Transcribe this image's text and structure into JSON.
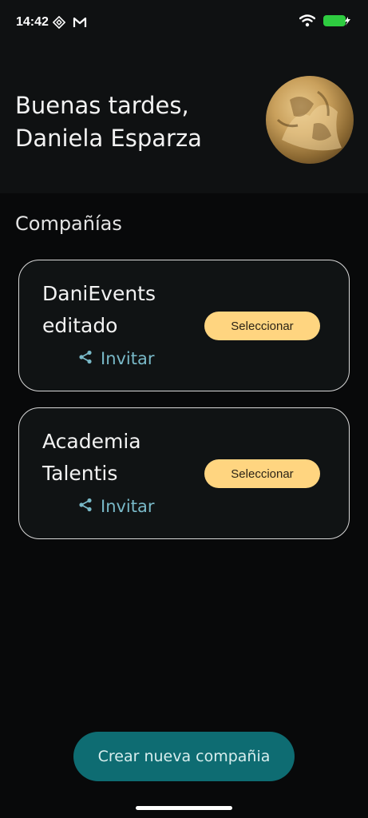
{
  "status_bar": {
    "time": "14:42",
    "icons": [
      "app-diamond-icon",
      "gmail-icon",
      "wifi-icon",
      "battery-charging-icon"
    ],
    "battery_color": "#2ecc40"
  },
  "header": {
    "greeting_line1": "Buenas tardes,",
    "greeting_line2": "Daniela Esparza"
  },
  "companies_section": {
    "title": "Compañías",
    "companies": [
      {
        "name_line1": "DaniEvents",
        "name_line2": "editado",
        "select_label": "Seleccionar",
        "invite_label": "Invitar"
      },
      {
        "name_line1": "Academia",
        "name_line2": "Talentis",
        "select_label": "Seleccionar",
        "invite_label": "Invitar"
      }
    ]
  },
  "create_button": {
    "label": "Crear nueva compañia"
  },
  "colors": {
    "accent_yellow": "#ffd580",
    "accent_teal": "#0e6c72",
    "invite_blue": "#79b9c8",
    "background": "#08090a"
  }
}
